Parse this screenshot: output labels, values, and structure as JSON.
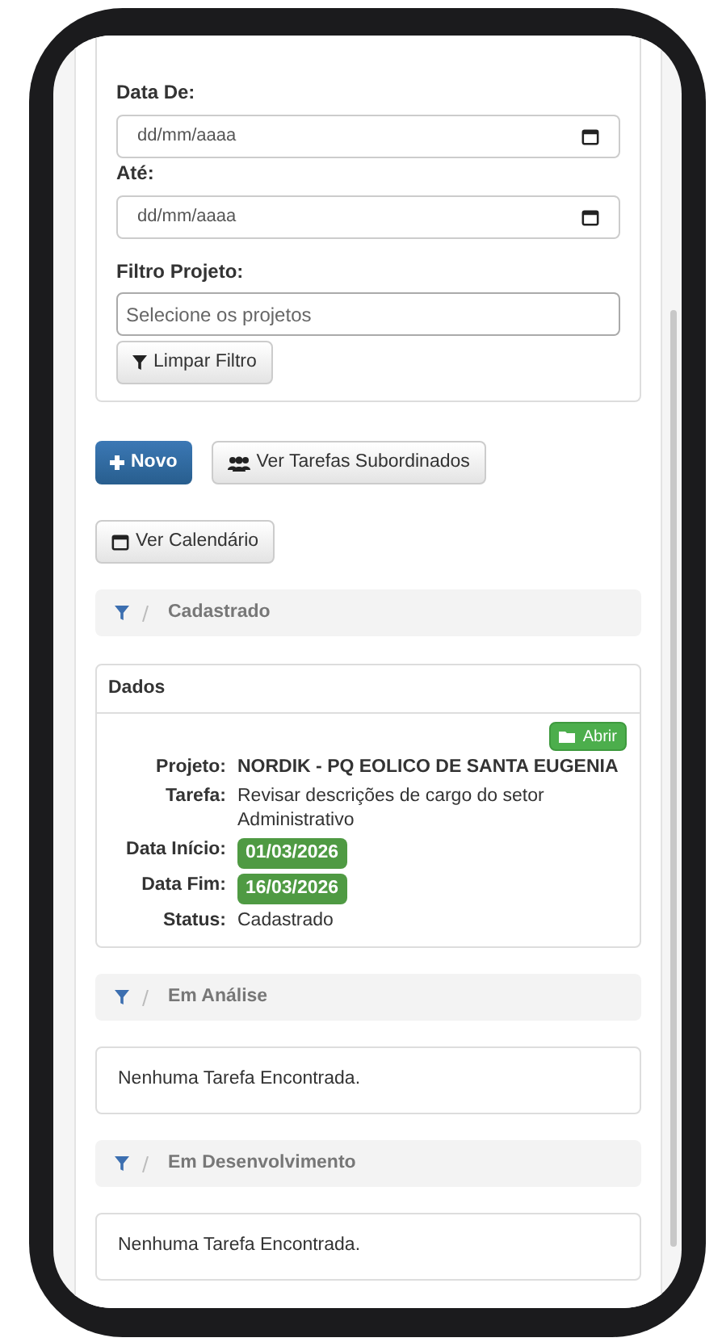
{
  "filters": {
    "date_from": {
      "label": "Data De:",
      "placeholder": "dd/mm/aaaa"
    },
    "date_to": {
      "label": "Até:",
      "placeholder": "dd/mm/aaaa"
    },
    "project": {
      "label": "Filtro Projeto:",
      "placeholder": "Selecione os projetos"
    },
    "clear_button": "Limpar Filtro"
  },
  "actions": {
    "new_button": "Novo",
    "subordinates_button": "Ver Tarefas Subordinados",
    "calendar_button": "Ver Calendário"
  },
  "sections": [
    {
      "title": "Cadastrado",
      "kind": "tasks",
      "panel_title": "Dados",
      "tasks": [
        {
          "open_button": "Abrir",
          "fields": [
            {
              "label": "Projeto:",
              "value": "NORDIK - PQ EOLICO DE SANTA EUGENIA",
              "kind": "bold"
            },
            {
              "label": "Tarefa:",
              "value": "Revisar descrições de cargo do setor Administrativo",
              "kind": "text"
            },
            {
              "label": "Data Início:",
              "value": "01/03/2026",
              "kind": "badge"
            },
            {
              "label": "Data Fim:",
              "value": "16/03/2026",
              "kind": "badge"
            },
            {
              "label": "Status:",
              "value": "Cadastrado",
              "kind": "text"
            }
          ]
        }
      ]
    },
    {
      "title": "Em Análise",
      "kind": "empty",
      "message": "Nenhuma Tarefa Encontrada."
    },
    {
      "title": "Em Desenvolvimento",
      "kind": "empty",
      "message": "Nenhuma Tarefa Encontrada."
    }
  ]
}
